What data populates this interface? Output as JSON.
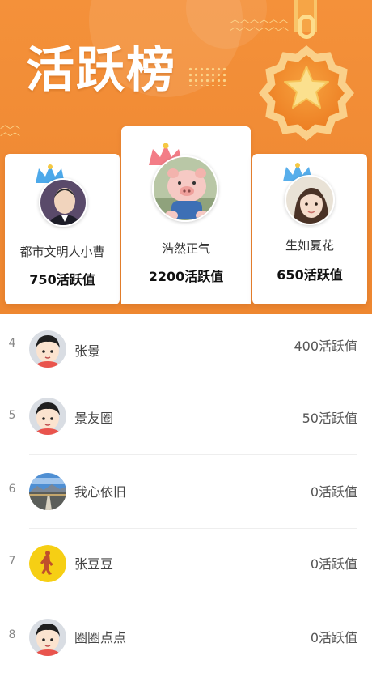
{
  "header": {
    "title": "活跃榜"
  },
  "podium": [
    {
      "rank": 2,
      "name": "都市文明人小曹",
      "score": "750活跃值",
      "avatar": "avatar-man-photo"
    },
    {
      "rank": 1,
      "name": "浩然正气",
      "score": "2200活跃值",
      "avatar": "avatar-pig-toy"
    },
    {
      "rank": 3,
      "name": "生如夏花",
      "score": "650活跃值",
      "avatar": "avatar-girl-photo"
    }
  ],
  "list": [
    {
      "rank": "4",
      "name": "张景",
      "score": "400活跃值",
      "avatar": "avatar-cartoon-boy"
    },
    {
      "rank": "5",
      "name": "景友圈",
      "score": "50活跃值",
      "avatar": "avatar-cartoon-boy"
    },
    {
      "rank": "6",
      "name": "我心依旧",
      "score": "0活跃值",
      "avatar": "avatar-landscape"
    },
    {
      "rank": "7",
      "name": "张豆豆",
      "score": "0活跃值",
      "avatar": "avatar-yellow-figure"
    },
    {
      "rank": "8",
      "name": "圈圈点点",
      "score": "0活跃值",
      "avatar": "avatar-cartoon-boy"
    }
  ],
  "colors": {
    "header_orange": "#f08a34",
    "medal_gold": "#fad08a",
    "crown_silver_blue": "#3aa0e8",
    "crown_gold": "#f5c842",
    "crown_pink": "#f26f7a"
  }
}
